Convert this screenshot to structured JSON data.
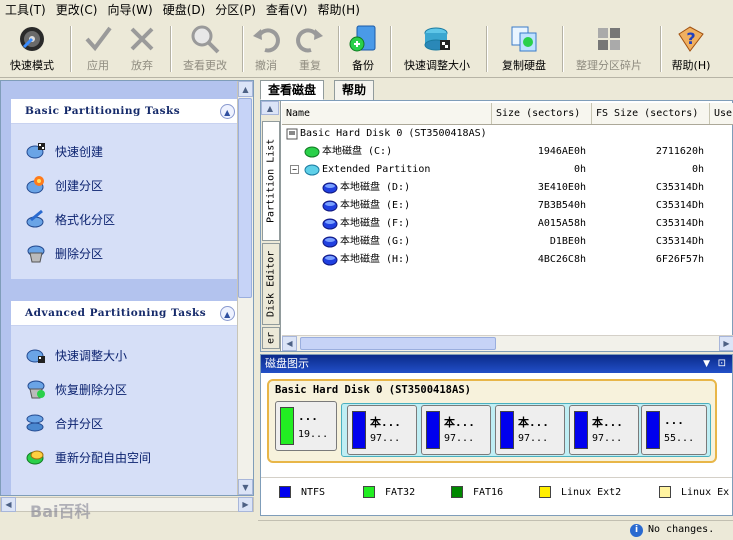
{
  "menu": [
    "工具(T)",
    "更改(C)",
    "向导(W)",
    "硬盘(D)",
    "分区(P)",
    "查看(V)",
    "帮助(H)"
  ],
  "toolbar": [
    {
      "label": "快速模式",
      "icon": "quick-mode-icon",
      "enabled": true
    },
    {
      "label": "应用",
      "icon": "checkmark-icon",
      "enabled": false
    },
    {
      "label": "放弃",
      "icon": "x-icon",
      "enabled": false
    },
    {
      "label": "查看更改",
      "icon": "magnifier-icon",
      "enabled": false
    },
    {
      "label": "撤消",
      "icon": "undo-icon",
      "enabled": false
    },
    {
      "label": "重复",
      "icon": "redo-icon",
      "enabled": false
    },
    {
      "label": "备份",
      "icon": "backup-icon",
      "enabled": true
    },
    {
      "label": "快速调整大小",
      "icon": "quick-resize-icon",
      "enabled": true
    },
    {
      "label": "复制硬盘",
      "icon": "copy-disk-icon",
      "enabled": true
    },
    {
      "label": "整理分区碎片",
      "icon": "defrag-icon",
      "enabled": false
    },
    {
      "label": "帮助(H)",
      "icon": "help-icon",
      "enabled": true
    }
  ],
  "basic_tasks": {
    "title": "Basic Partitioning Tasks",
    "items": [
      "快速创建",
      "创建分区",
      "格式化分区",
      "删除分区"
    ]
  },
  "advanced_tasks": {
    "title": "Advanced Partitioning Tasks",
    "items": [
      "快速调整大小",
      "恢复删除分区",
      "合并分区",
      "重新分配自由空间"
    ]
  },
  "tabs": [
    "查看磁盘",
    "帮助"
  ],
  "side_tabs": [
    "Partition List",
    "Disk Editor",
    "er"
  ],
  "columns": [
    "Name",
    "Size (sectors)",
    "FS Size (sectors)",
    "Use"
  ],
  "rows": [
    {
      "name": "Basic Hard Disk 0 (ST3500418AS)",
      "size": "",
      "fs": "",
      "level": 0,
      "type": "disk"
    },
    {
      "name": "本地磁盘 (C:)",
      "size": "1946AE0h",
      "fs": "2711620h",
      "level": 1,
      "type": "fat32"
    },
    {
      "name": "Extended Partition",
      "size": "0h",
      "fs": "0h",
      "level": 1,
      "type": "extended"
    },
    {
      "name": "本地磁盘 (D:)",
      "size": "3E410E0h",
      "fs": "C35314Dh",
      "level": 2,
      "type": "ntfs"
    },
    {
      "name": "本地磁盘 (E:)",
      "size": "7B3B540h",
      "fs": "C35314Dh",
      "level": 2,
      "type": "ntfs"
    },
    {
      "name": "本地磁盘 (F:)",
      "size": "A015A58h",
      "fs": "C35314Dh",
      "level": 2,
      "type": "ntfs"
    },
    {
      "name": "本地磁盘 (G:)",
      "size": "D1BE0h",
      "fs": "C35314Dh",
      "level": 2,
      "type": "ntfs"
    },
    {
      "name": "本地磁盘 (H:)",
      "size": "4BC26C8h",
      "fs": "6F26F57h",
      "level": 2,
      "type": "ntfs"
    }
  ],
  "diskmap": {
    "title": "磁盘图示",
    "disk_label": "Basic Hard Disk 0 (ST3500418AS)",
    "partitions": [
      {
        "t1": "...",
        "t2": "19...",
        "color": "#22ee22"
      },
      {
        "t1": "本...",
        "t2": "97...",
        "color": "#0000ee"
      },
      {
        "t1": "本...",
        "t2": "97...",
        "color": "#0000ee"
      },
      {
        "t1": "本...",
        "t2": "97...",
        "color": "#0000ee"
      },
      {
        "t1": "本...",
        "t2": "97...",
        "color": "#0000ee"
      },
      {
        "t1": "...",
        "t2": "55...",
        "color": "#0000ee"
      }
    ]
  },
  "legend": [
    {
      "label": "NTFS",
      "color": "#0000ee"
    },
    {
      "label": "FAT32",
      "color": "#22ee22"
    },
    {
      "label": "FAT16",
      "color": "#008800"
    },
    {
      "label": "Linux Ext2",
      "color": "#ffee00"
    },
    {
      "label": "Linux Ex",
      "color": "#fff3a0"
    }
  ],
  "status": "No changes.",
  "watermark": "Bai百科"
}
